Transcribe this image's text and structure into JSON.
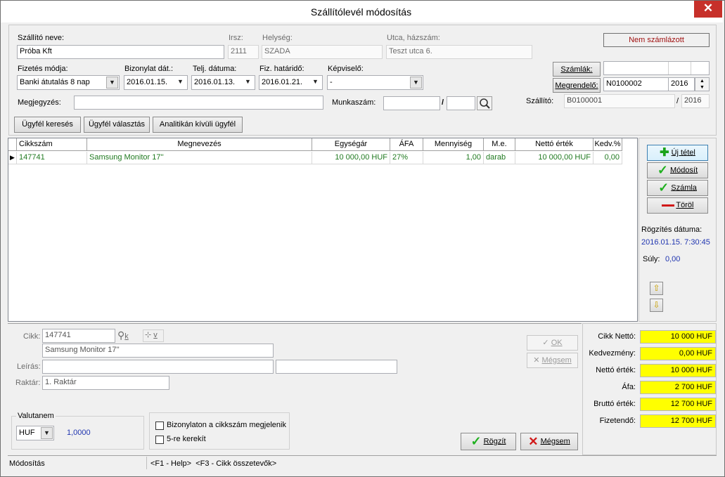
{
  "window": {
    "title": "Szállítólevél módosítás",
    "close_glyph": "✕"
  },
  "header": {
    "supplier_name_label": "Szállító neve:",
    "supplier_name": "Próba Kft",
    "zip_label": "Irsz:",
    "zip": "2111",
    "city_label": "Helység:",
    "city": "SZADA",
    "street_label": "Utca, házszám:",
    "street": "Teszt utca 6.",
    "invoice_status": "Nem számlázott",
    "payment_label": "Fizetés módja:",
    "payment": "Banki átutalás   8 nap",
    "doc_date_label": "Bizonylat dát.:",
    "doc_date": "2016.01.15.",
    "perf_date_label": "Telj. dátuma:",
    "perf_date": "2016.01.13.",
    "due_date_label": "Fiz. határidő:",
    "due_date": "2016.01.21.",
    "rep_label": "Képviselő:",
    "rep": "-",
    "invoices_button": "Számlák:",
    "order_button": "Megrendelő:",
    "order_no": "N0100002",
    "order_year": "2016",
    "note_label": "Megjegyzés:",
    "note": "",
    "job_label": "Munkaszám:",
    "job_no": "",
    "job_sep": "/",
    "job_year": "",
    "delivery_label": "Szállító:",
    "delivery_no": "B0100001",
    "delivery_sep": "/",
    "delivery_year": "2016"
  },
  "customer_buttons": {
    "search": "Ügyfél keresés",
    "select": "Ügyfél választás",
    "non_analytic": "Analitikán kívüli ügyfél"
  },
  "table": {
    "columns": [
      "Cikkszám",
      "Megnevezés",
      "Egységár",
      "ÁFA",
      "Mennyiség",
      "M.e.",
      "Nettó érték",
      "Kedv.%"
    ],
    "rows": [
      {
        "code": "147741",
        "name": "Samsung Monitor 17''",
        "unit_price": "10 000,00 HUF",
        "vat": "27%",
        "qty": "1,00",
        "unit": "darab",
        "net": "10 000,00 HUF",
        "disc": "0,00"
      }
    ]
  },
  "side_actions": {
    "new_item": "Új tétel",
    "modify": "Módosít",
    "invoice": "Számla",
    "delete": "Töröl",
    "rec_date_label": "Rögzítés dátuma:",
    "rec_date": "2016.01.15. 7:30:45",
    "weight_label": "Súly:",
    "weight": "0,00"
  },
  "item_editor": {
    "item_label": "Cikk:",
    "item_code": "147741",
    "k_label": "k",
    "v_label": "v",
    "item_name": "Samsung Monitor 17''",
    "desc_label": "Leírás:",
    "desc1": "",
    "desc2": "",
    "store_label": "Raktár:",
    "store": "1. Raktár",
    "ok": "OK",
    "cancel": "Mégsem"
  },
  "currency": {
    "legend": "Valutanem",
    "code": "HUF",
    "rate": "1,0000"
  },
  "options": {
    "show_code": "Bizonylaton a cikkszám megjelenik",
    "round5": "5-re kerekít"
  },
  "footer_buttons": {
    "save": "Rögzít",
    "cancel": "Mégsem"
  },
  "totals": [
    {
      "label": "Cikk Nettó:",
      "value": "10 000 HUF"
    },
    {
      "label": "Kedvezmény:",
      "value": "0,00 HUF"
    },
    {
      "label": "Nettó érték:",
      "value": "10 000 HUF"
    },
    {
      "label": "Áfa:",
      "value": "2 700 HUF"
    },
    {
      "label": "Bruttó érték:",
      "value": "12 700 HUF"
    },
    {
      "label": "Fizetendő:",
      "value": "12 700 HUF"
    }
  ],
  "status": {
    "mode": "Módosítás",
    "help": "<F1 - Help>  <F3 - Cikk összetevők>"
  },
  "colors": {
    "row_text": "#207a20",
    "info_text": "#2035b0",
    "total_bg": "#ffff00",
    "close_bg": "#c7302a"
  }
}
